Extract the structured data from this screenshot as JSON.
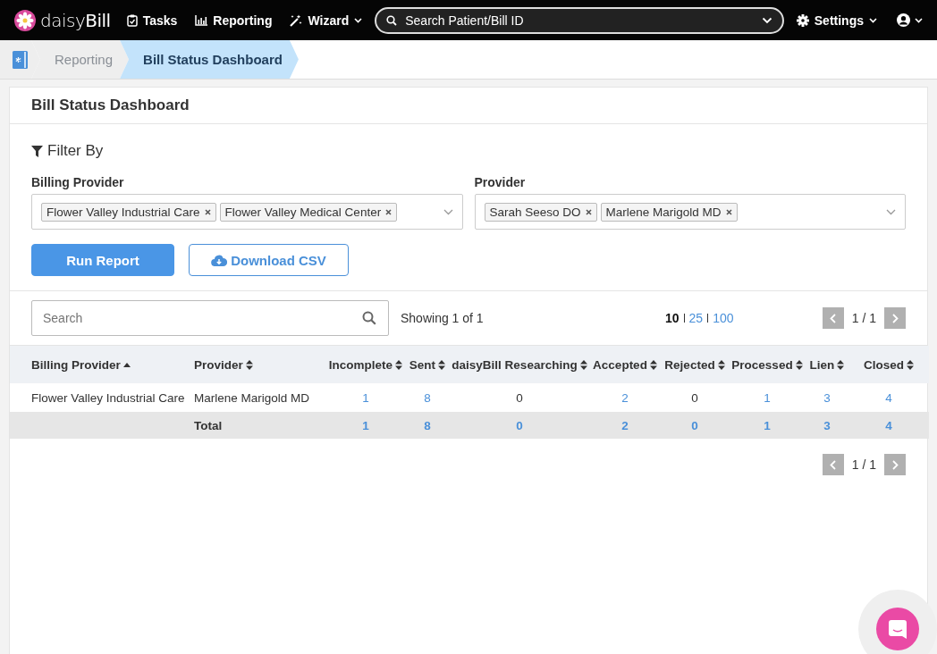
{
  "nav": {
    "logo": "daisy**Bill**",
    "items": [
      {
        "label": "Tasks",
        "kind": "clipboard",
        "dropdown": false
      },
      {
        "label": "Reporting",
        "kind": "chart",
        "dropdown": false
      },
      {
        "label": "Wizard",
        "kind": "wand",
        "dropdown": true
      }
    ],
    "search": {
      "placeholder": "Search Patient/Bill ID"
    },
    "settings": "Settings"
  },
  "breadcrumbs": [
    {
      "label": "Reporting",
      "selected": false
    },
    {
      "label": "Bill Status Dashboard",
      "selected": true
    }
  ],
  "title": "Bill Status Dashboard",
  "filter_title": "Filter By",
  "filters": [
    {
      "label": "Billing Provider",
      "tags": [
        "Flower Valley Industrial Care",
        "Flower Valley Medical Center"
      ]
    },
    {
      "label": "Provider",
      "tags": [
        "Sarah Seeso DO",
        "Marlene Marigold MD"
      ]
    }
  ],
  "buttons": [
    {
      "label": "Run Report",
      "kind": "primary"
    },
    {
      "label": "Download CSV",
      "kind": "outline"
    }
  ],
  "table_search": {
    "placeholder": "Search"
  },
  "showing": "Showing 1 of 1",
  "page_sizes": [
    {
      "label": "10",
      "selected": true
    },
    {
      "label": "25",
      "selected": false
    },
    {
      "label": "100",
      "selected": false
    }
  ],
  "pager_top": "1 / 1",
  "columns": [
    {
      "label": "Billing Provider",
      "sorted": true
    },
    {
      "label": "Provider",
      "sorted": false
    },
    {
      "label": "Incomplete",
      "sorted": false
    },
    {
      "label": "Sent",
      "sorted": false
    },
    {
      "label": "daisyBill Researching",
      "sorted": false
    },
    {
      "label": "Accepted",
      "sorted": false
    },
    {
      "label": "Rejected",
      "sorted": false
    },
    {
      "label": "Processed",
      "sorted": false
    },
    {
      "label": "Lien",
      "sorted": false
    },
    {
      "label": "Closed",
      "sorted": false
    }
  ],
  "rows": [
    {
      "kind": "data",
      "cells": [
        {
          "text": "Flower Valley Industrial Care",
          "link": false
        },
        {
          "text": "Marlene Marigold MD",
          "link": false
        },
        {
          "text": "1",
          "link": true
        },
        {
          "text": "8",
          "link": true
        },
        {
          "text": "0",
          "link": false
        },
        {
          "text": "2",
          "link": true
        },
        {
          "text": "0",
          "link": false
        },
        {
          "text": "1",
          "link": true
        },
        {
          "text": "3",
          "link": true
        },
        {
          "text": "4",
          "link": true
        }
      ]
    },
    {
      "kind": "total",
      "cells": [
        {
          "text": "Total",
          "link": false
        },
        {
          "text": "1",
          "link": true
        },
        {
          "text": "8",
          "link": true
        },
        {
          "text": "0",
          "link": true
        },
        {
          "text": "2",
          "link": true
        },
        {
          "text": "0",
          "link": true
        },
        {
          "text": "1",
          "link": true
        },
        {
          "text": "3",
          "link": true
        },
        {
          "text": "4",
          "link": true
        }
      ]
    }
  ],
  "pager_bottom": "1 / 1"
}
